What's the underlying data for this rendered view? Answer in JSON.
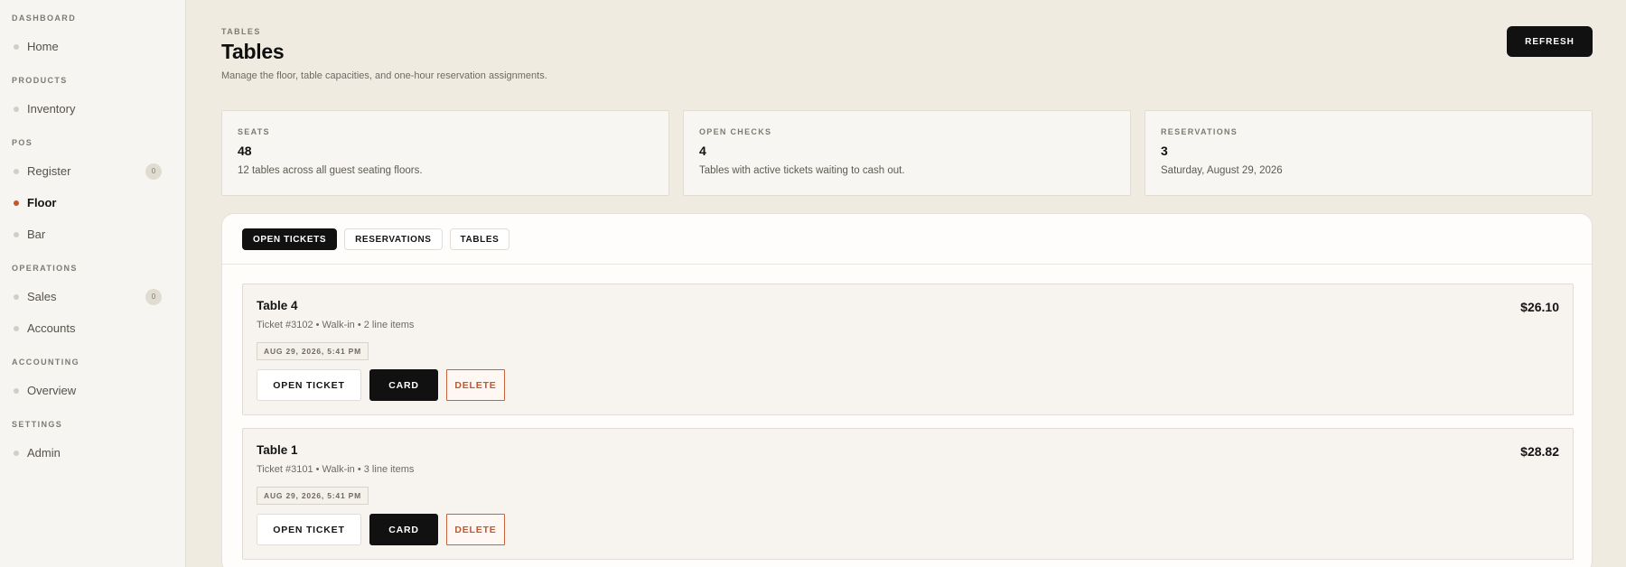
{
  "sidebar": {
    "sections": [
      {
        "heading": "DASHBOARD",
        "items": [
          {
            "label": "Home"
          }
        ]
      },
      {
        "heading": "PRODUCTS",
        "items": [
          {
            "label": "Inventory"
          }
        ]
      },
      {
        "heading": "POS",
        "items": [
          {
            "label": "Register",
            "badge": "0"
          },
          {
            "label": "Floor"
          },
          {
            "label": "Bar"
          }
        ]
      },
      {
        "heading": "OPERATIONS",
        "items": [
          {
            "label": "Sales",
            "badge": "0"
          },
          {
            "label": "Accounts"
          }
        ]
      },
      {
        "heading": "ACCOUNTING",
        "items": [
          {
            "label": "Overview"
          }
        ]
      },
      {
        "heading": "SETTINGS",
        "items": [
          {
            "label": "Admin"
          }
        ]
      }
    ]
  },
  "header": {
    "eyebrow": "TABLES",
    "title": "Tables",
    "description": "Manage the floor, table capacities, and one-hour reservation assignments.",
    "refresh_label": "REFRESH"
  },
  "stats": [
    {
      "label": "SEATS",
      "value": "48",
      "note": "12 tables across all guest seating floors."
    },
    {
      "label": "OPEN CHECKS",
      "value": "4",
      "note": "Tables with active tickets waiting to cash out."
    },
    {
      "label": "RESERVATIONS",
      "value": "3",
      "note": "Saturday, August 29, 2026"
    }
  ],
  "tabs": [
    {
      "label": "OPEN TICKETS"
    },
    {
      "label": "RESERVATIONS"
    },
    {
      "label": "TABLES"
    }
  ],
  "tickets": [
    {
      "title": "Table 4",
      "meta": "Ticket #3102 • Walk-in • 2 line items",
      "amount": "$26.10",
      "time": "AUG 29, 2026, 5:41 PM"
    },
    {
      "title": "Table 1",
      "meta": "Ticket #3101 • Walk-in • 3 line items",
      "amount": "$28.82",
      "time": "AUG 29, 2026, 5:41 PM"
    }
  ],
  "actions": {
    "open_label": "OPEN TICKET",
    "card_label": "CARD",
    "delete_label": "DELETE"
  },
  "colors": {
    "accent": "#c4552c",
    "primary_button": "#111111",
    "page_background": "#f0ebe1"
  }
}
